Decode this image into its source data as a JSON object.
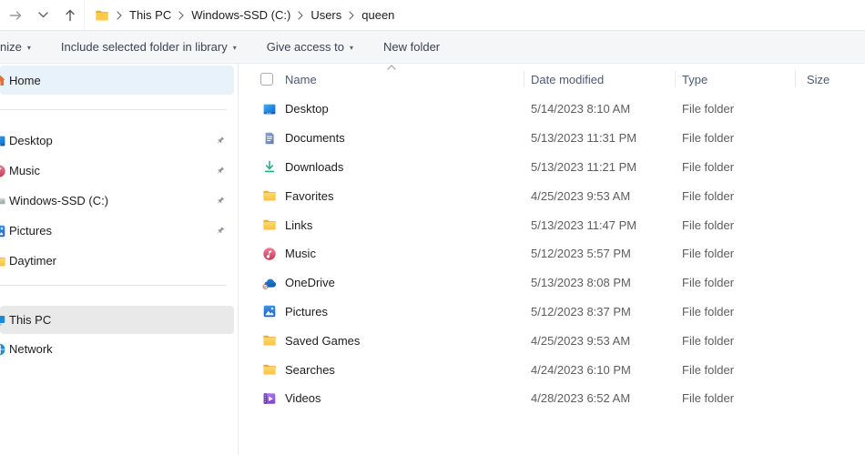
{
  "navbar": {
    "breadcrumb": [
      "This PC",
      "Windows-SSD (C:)",
      "Users",
      "queen"
    ]
  },
  "toolbar": {
    "organize_label": "nize",
    "include_label": "Include selected folder in library",
    "give_access_label": "Give access to",
    "new_folder_label": "New folder"
  },
  "sidebar": {
    "home": {
      "label": "Home",
      "icon": "home-icon",
      "selected": true
    },
    "pinned": [
      {
        "label": "Desktop",
        "icon": "desktop-icon",
        "pinned": true
      },
      {
        "label": "Music",
        "icon": "music-icon",
        "pinned": true
      },
      {
        "label": "Windows-SSD (C:)",
        "icon": "drive-icon",
        "pinned": true
      },
      {
        "label": "Pictures",
        "icon": "pictures-icon",
        "pinned": true
      },
      {
        "label": "Daytimer",
        "icon": "folder-icon",
        "pinned": false
      }
    ],
    "bottom": [
      {
        "label": "This PC",
        "icon": "this-pc-icon",
        "selected": true
      },
      {
        "label": "Network",
        "icon": "network-icon",
        "selected": false
      }
    ]
  },
  "table": {
    "columns": {
      "name": "Name",
      "date": "Date modified",
      "type": "Type",
      "size": "Size"
    },
    "sort": {
      "column": "Name",
      "direction": "ascending"
    },
    "rows": [
      {
        "name": "Desktop",
        "icon": "desktop-icon",
        "date": "5/14/2023 8:10 AM",
        "type": "File folder",
        "size": ""
      },
      {
        "name": "Documents",
        "icon": "documents-icon",
        "date": "5/13/2023 11:31 PM",
        "type": "File folder",
        "size": ""
      },
      {
        "name": "Downloads",
        "icon": "downloads-icon",
        "date": "5/13/2023 11:21 PM",
        "type": "File folder",
        "size": ""
      },
      {
        "name": "Favorites",
        "icon": "folder-icon",
        "date": "4/25/2023 9:53 AM",
        "type": "File folder",
        "size": ""
      },
      {
        "name": "Links",
        "icon": "folder-icon",
        "date": "5/13/2023 11:47 PM",
        "type": "File folder",
        "size": ""
      },
      {
        "name": "Music",
        "icon": "music-icon",
        "date": "5/12/2023 5:57 PM",
        "type": "File folder",
        "size": ""
      },
      {
        "name": "OneDrive",
        "icon": "onedrive-icon",
        "date": "5/13/2023 8:08 PM",
        "type": "File folder",
        "size": ""
      },
      {
        "name": "Pictures",
        "icon": "pictures-icon",
        "date": "5/12/2023 8:37 PM",
        "type": "File folder",
        "size": ""
      },
      {
        "name": "Saved Games",
        "icon": "folder-icon",
        "date": "4/25/2023 9:53 AM",
        "type": "File folder",
        "size": ""
      },
      {
        "name": "Searches",
        "icon": "folder-icon",
        "date": "4/24/2023 6:10 PM",
        "type": "File folder",
        "size": ""
      },
      {
        "name": "Videos",
        "icon": "videos-icon",
        "date": "4/28/2023 6:52 AM",
        "type": "File folder",
        "size": ""
      }
    ]
  },
  "colors": {
    "selection_blue": "#e7f2fb",
    "selection_gray": "#e9e9e9",
    "folder_yellow": "#ffc94a",
    "header_text": "#4a5b76"
  }
}
